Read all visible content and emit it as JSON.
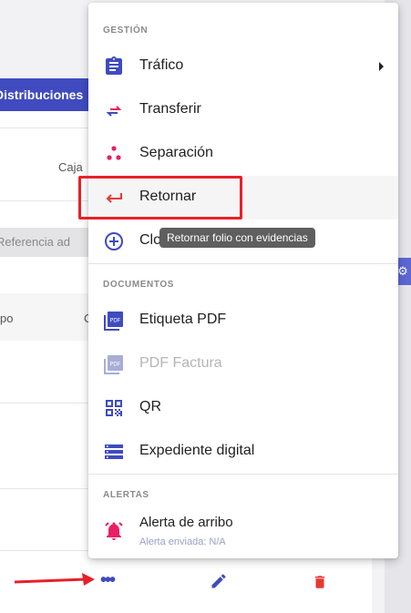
{
  "background": {
    "tab_label": "Distribuciones",
    "column_caja": "Caja",
    "input_placeholder": "Referencia ad",
    "col_po": "po",
    "col_c": "C"
  },
  "menu": {
    "sections": {
      "gestion": "GESTIÓN",
      "documentos": "DOCUMENTOS",
      "alertas": "ALERTAS"
    },
    "items": {
      "trafico": "Tráfico",
      "transferir": "Transferir",
      "separacion": "Separación",
      "retornar": "Retornar",
      "clo": "Clo",
      "etiqueta_pdf": "Etiqueta PDF",
      "pdf_factura": "PDF Factura",
      "qr": "QR",
      "expediente": "Expediente digital",
      "alerta_arribo": "Alerta de arribo",
      "alerta_sub": "Alerta enviada: N/A"
    },
    "tooltip": "Retornar folio con evidencias"
  },
  "icons": {
    "trafico": "clipboard-icon",
    "transferir": "swap-arrows-icon",
    "separacion": "dots-split-icon",
    "retornar": "return-arrow-icon",
    "clo": "add-circle-icon",
    "etiqueta_pdf": "pdf-icon",
    "pdf_factura": "pdf-icon",
    "qr": "qr-code-icon",
    "expediente": "list-storage-icon",
    "alerta": "alarm-bell-icon"
  },
  "colors": {
    "primary": "#3f4bbf",
    "accent_pink": "#e91e63",
    "danger": "#e53935",
    "highlight_border": "#e8202a"
  }
}
